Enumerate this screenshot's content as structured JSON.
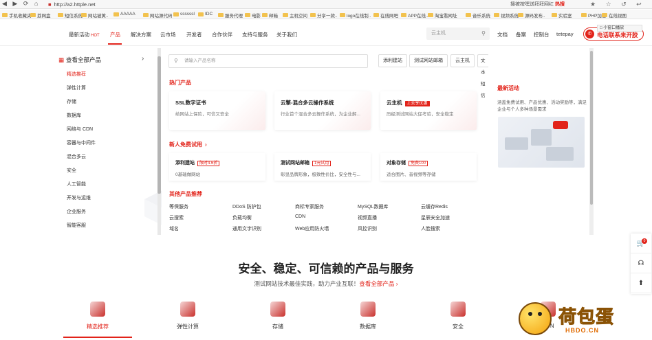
{
  "browser": {
    "nav_glyphs": "◀ ▶ ⟳ ⌂",
    "url": "http://a2.httple.net",
    "search_text": "搜被按嘿送拜拜网红",
    "search_hot": "热搜",
    "tool_glyphs": "★ ☆ ↺ ↩ ☰"
  },
  "bookmarks": [
    "手机收藏夹",
    "荔网盘",
    "短信系统",
    "网站被黄..",
    "AAAAA",
    "网站源代码",
    "ssssssl",
    "IDC",
    "服务代理",
    "电影",
    "邮箱",
    "主机空间",
    "分享一款..",
    "logo在线制..",
    "在线网吧",
    "APP在线..",
    "淘宝看网址",
    "音乐系统",
    "视频系统",
    "源码发布..",
    "实验室",
    "PHP加密",
    "在线视图"
  ],
  "header": {
    "nav": [
      {
        "label": "最新活动",
        "badge": "HOT"
      },
      {
        "label": "产品",
        "active": true
      },
      {
        "label": "解决方案"
      },
      {
        "label": "云市场"
      },
      {
        "label": "开发者"
      },
      {
        "label": "合作伙伴"
      },
      {
        "label": "支持与服务"
      },
      {
        "label": "关于我们"
      }
    ],
    "search_placeholder": "云主机",
    "right_links": [
      "文档",
      "备案",
      "控制台",
      "tetepay"
    ],
    "call_label": "电话联系来开胶",
    "mini_window": "□ 小窗口播放"
  },
  "sidebar": {
    "all_products": "查看全部产品",
    "categories": [
      {
        "label": "精选推荐",
        "active": true
      },
      {
        "label": "弹性计算"
      },
      {
        "label": "存储"
      },
      {
        "label": "数据库"
      },
      {
        "label": "网络与 CDN"
      },
      {
        "label": "容器与中间件"
      },
      {
        "label": "混合多云"
      },
      {
        "label": "安全"
      },
      {
        "label": "人工智能"
      },
      {
        "label": "开发与运维"
      },
      {
        "label": "企业服务"
      },
      {
        "label": "智能客服"
      }
    ]
  },
  "main": {
    "search_placeholder": "请输入产品名称",
    "quick_buttons": [
      "添利建站",
      "测试网站邮箱",
      "云主机",
      "文本短信"
    ],
    "hot_title": "热门产品",
    "hot_cards": [
      {
        "title": "SSL数字证书",
        "tag": "",
        "desc": "给网站上保险，可信又安全"
      },
      {
        "title": "云擎-混合多云操作系统",
        "tag": "",
        "desc": "行业首个混合多云操作系统，为企业解..."
      },
      {
        "title": "云主机",
        "tag": "上云享优惠",
        "desc": "历经测试网站大促考验，安全稳定"
      }
    ],
    "trial_title": "新人免费试用",
    "trial_arrow": "›",
    "trial_cards": [
      {
        "title": "添利建站",
        "tag": "限时4.6折",
        "desc": "0基础做网站"
      },
      {
        "title": "测试网站邮箱",
        "tag": "1元试用",
        "desc": "彰显品牌形象，极致性价比，安全性与..."
      },
      {
        "title": "对象存储",
        "tag": "免费100",
        "desc": "适合图片、音视频等存储"
      }
    ],
    "other_title": "其他产品推荐",
    "other_products": [
      [
        "等保服务",
        "DDoS 防护包",
        "商标专家服务",
        "MySQL数据库",
        "云缓存Redis"
      ],
      [
        "云搜索",
        "负载均衡",
        "CDN",
        "视频直播",
        "星辰安全加速"
      ],
      [
        "域名",
        "通用文字识别",
        "Web应用防火墙",
        "风控识别",
        "人脸搜索"
      ]
    ]
  },
  "activity": {
    "title": "最新活动",
    "desc": "涵盖免费试用、产品优惠、活动奖励等，满足企业与个人多种场景需求"
  },
  "bottom": {
    "title": "安全、稳定、可信赖的产品与服务",
    "subtitle": "测试网站技术最佳实践，助力产业互联！",
    "subtitle_link": "查看全部产品 ›",
    "tabs": [
      "精选推荐",
      "弹性计算",
      "存储",
      "数据库",
      "安全",
      "CDN"
    ]
  },
  "float_bar": {
    "cart_count": "0"
  },
  "logo": {
    "word": "荷包蛋",
    "domain": "HBDO.CN"
  },
  "colors": {
    "accent": "#e2231a"
  }
}
